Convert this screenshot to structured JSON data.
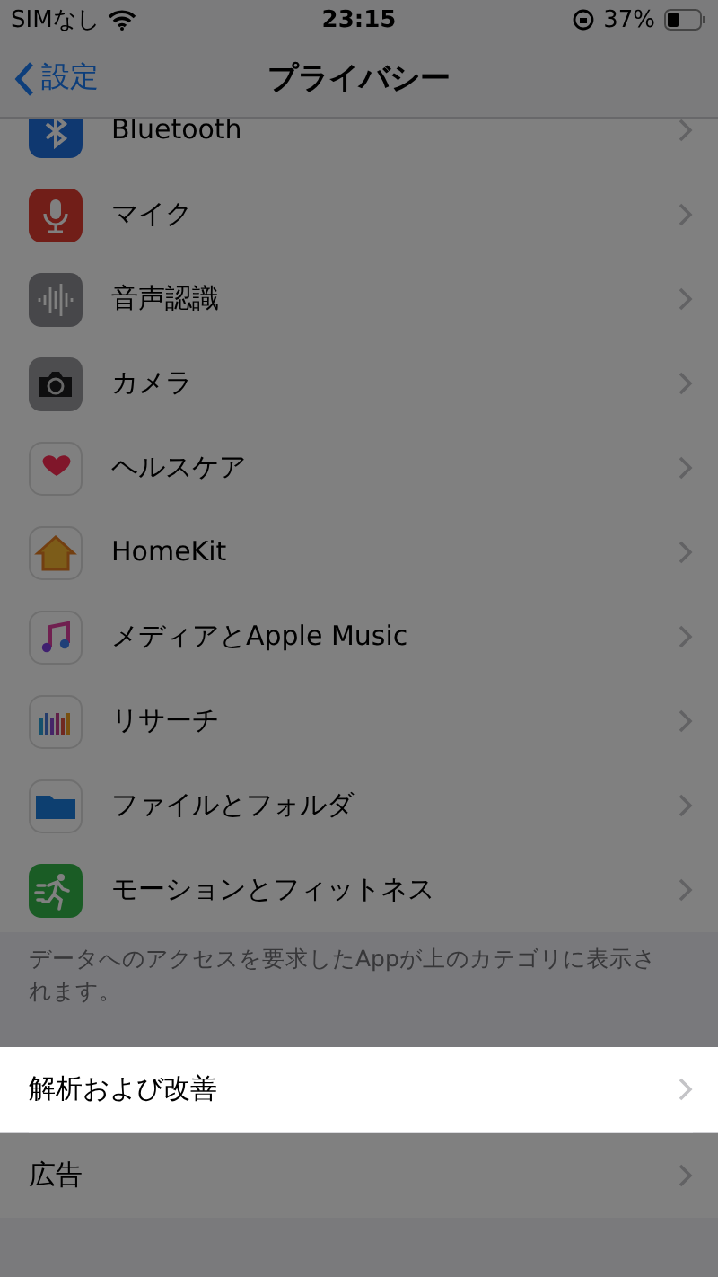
{
  "status_bar": {
    "carrier": "SIMなし",
    "time": "23:15",
    "battery": "37%"
  },
  "nav": {
    "back": "設定",
    "title": "プライバシー"
  },
  "groups": [
    {
      "rows": [
        {
          "kind": "bluetooth",
          "label": "Bluetooth",
          "highlighted": false
        },
        {
          "kind": "microphone",
          "label": "マイク",
          "highlighted": false
        },
        {
          "kind": "speech",
          "label": "音声認識",
          "highlighted": false
        },
        {
          "kind": "camera",
          "label": "カメラ",
          "highlighted": false
        },
        {
          "kind": "health",
          "label": "ヘルスケア",
          "highlighted": false
        },
        {
          "kind": "home",
          "label": "HomeKit",
          "highlighted": false
        },
        {
          "kind": "music",
          "label": "メディアとApple Music",
          "highlighted": false
        },
        {
          "kind": "research",
          "label": "リサーチ",
          "highlighted": false
        },
        {
          "kind": "files",
          "label": "ファイルとフォルダ",
          "highlighted": false
        },
        {
          "kind": "motion",
          "label": "モーションとフィットネス",
          "highlighted": false
        }
      ],
      "footer": "データへのアクセスを要求したAppが上のカテゴリに表示されます。"
    },
    {
      "rows": [
        {
          "label": "解析および改善",
          "highlighted": true
        },
        {
          "label": "広告",
          "highlighted": false
        }
      ]
    }
  ]
}
